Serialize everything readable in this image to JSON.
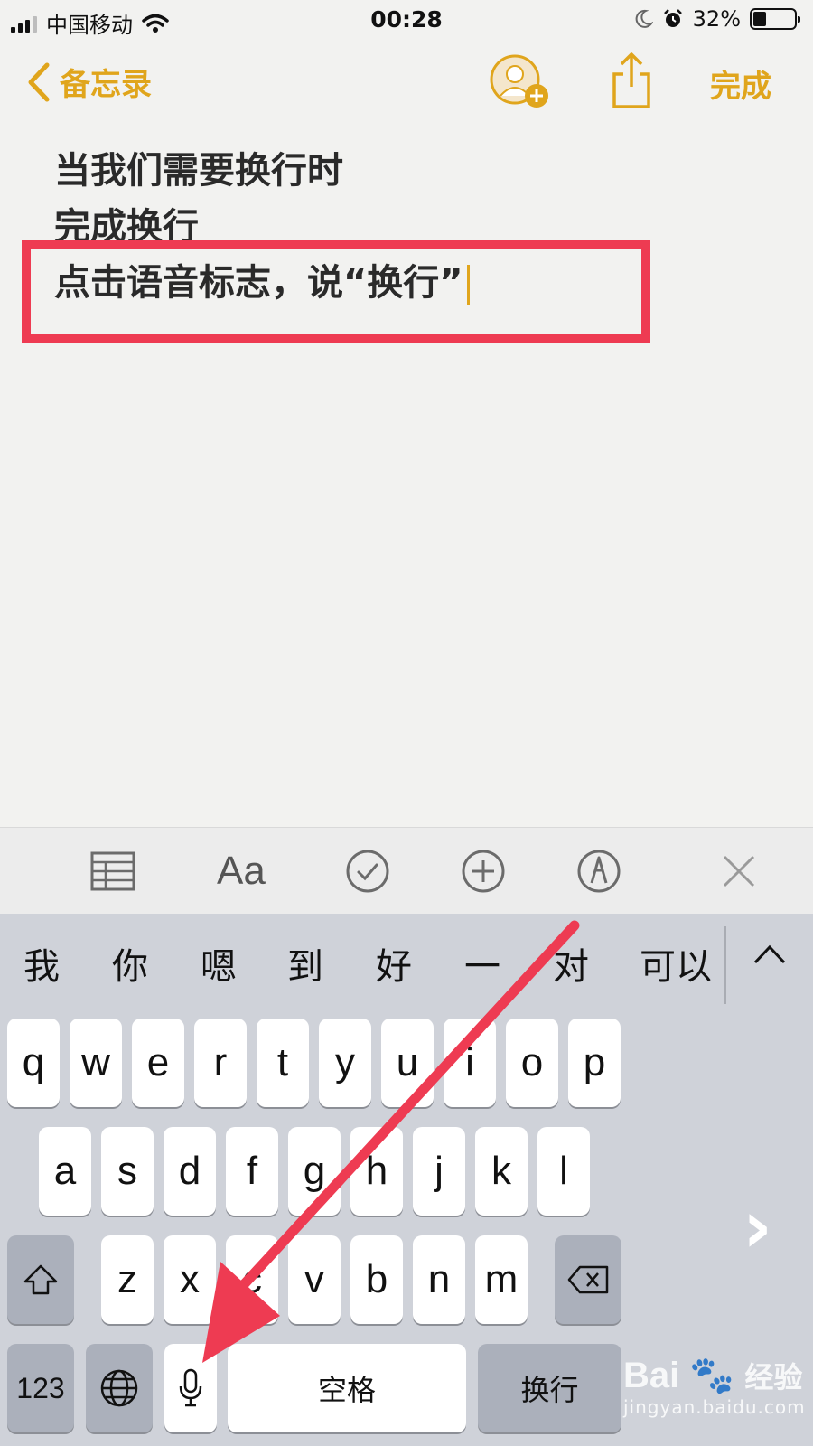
{
  "status": {
    "carrier": "中国移动",
    "time": "00:28",
    "battery": "32%",
    "battery_level": 0.32
  },
  "nav": {
    "back_label": "备忘录",
    "done_label": "完成"
  },
  "note": {
    "lines": [
      "当我们需要换行时",
      "完成换行",
      "点击语音标志，说“换行”"
    ]
  },
  "format_bar": {
    "items": [
      "table-icon",
      "text-format",
      "checklist-icon",
      "add-circle-icon",
      "markup-icon",
      "close-icon"
    ],
    "text_format_label": "Aa"
  },
  "keyboard": {
    "predictions": [
      "我",
      "你",
      "嗯",
      "到",
      "好",
      "一",
      "对",
      "可以"
    ],
    "row1": [
      "q",
      "w",
      "e",
      "r",
      "t",
      "y",
      "u",
      "i",
      "o",
      "p"
    ],
    "row2": [
      "a",
      "s",
      "d",
      "f",
      "g",
      "h",
      "j",
      "k",
      "l"
    ],
    "row3": [
      "z",
      "x",
      "c",
      "v",
      "b",
      "n",
      "m"
    ],
    "numbers_label": "123",
    "space_label": "空格",
    "return_label": "换行",
    "next_label": "›"
  },
  "colors": {
    "accent": "#e0a51c",
    "annotation_red": "#ee3b52"
  },
  "watermark": {
    "brand": "Bai",
    "brand_suffix": "经验",
    "url": "jingyan.baidu.com"
  }
}
